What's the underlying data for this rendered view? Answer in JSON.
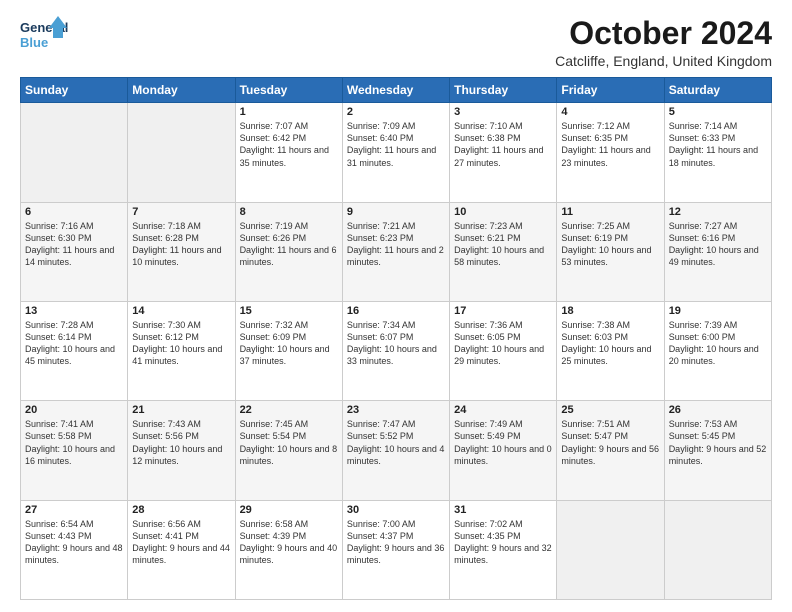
{
  "logo": {
    "line1": "General",
    "line2": "Blue"
  },
  "title": "October 2024",
  "location": "Catcliffe, England, United Kingdom",
  "days_header": [
    "Sunday",
    "Monday",
    "Tuesday",
    "Wednesday",
    "Thursday",
    "Friday",
    "Saturday"
  ],
  "weeks": [
    [
      {
        "day": "",
        "text": ""
      },
      {
        "day": "",
        "text": ""
      },
      {
        "day": "1",
        "text": "Sunrise: 7:07 AM\nSunset: 6:42 PM\nDaylight: 11 hours and 35 minutes."
      },
      {
        "day": "2",
        "text": "Sunrise: 7:09 AM\nSunset: 6:40 PM\nDaylight: 11 hours and 31 minutes."
      },
      {
        "day": "3",
        "text": "Sunrise: 7:10 AM\nSunset: 6:38 PM\nDaylight: 11 hours and 27 minutes."
      },
      {
        "day": "4",
        "text": "Sunrise: 7:12 AM\nSunset: 6:35 PM\nDaylight: 11 hours and 23 minutes."
      },
      {
        "day": "5",
        "text": "Sunrise: 7:14 AM\nSunset: 6:33 PM\nDaylight: 11 hours and 18 minutes."
      }
    ],
    [
      {
        "day": "6",
        "text": "Sunrise: 7:16 AM\nSunset: 6:30 PM\nDaylight: 11 hours and 14 minutes."
      },
      {
        "day": "7",
        "text": "Sunrise: 7:18 AM\nSunset: 6:28 PM\nDaylight: 11 hours and 10 minutes."
      },
      {
        "day": "8",
        "text": "Sunrise: 7:19 AM\nSunset: 6:26 PM\nDaylight: 11 hours and 6 minutes."
      },
      {
        "day": "9",
        "text": "Sunrise: 7:21 AM\nSunset: 6:23 PM\nDaylight: 11 hours and 2 minutes."
      },
      {
        "day": "10",
        "text": "Sunrise: 7:23 AM\nSunset: 6:21 PM\nDaylight: 10 hours and 58 minutes."
      },
      {
        "day": "11",
        "text": "Sunrise: 7:25 AM\nSunset: 6:19 PM\nDaylight: 10 hours and 53 minutes."
      },
      {
        "day": "12",
        "text": "Sunrise: 7:27 AM\nSunset: 6:16 PM\nDaylight: 10 hours and 49 minutes."
      }
    ],
    [
      {
        "day": "13",
        "text": "Sunrise: 7:28 AM\nSunset: 6:14 PM\nDaylight: 10 hours and 45 minutes."
      },
      {
        "day": "14",
        "text": "Sunrise: 7:30 AM\nSunset: 6:12 PM\nDaylight: 10 hours and 41 minutes."
      },
      {
        "day": "15",
        "text": "Sunrise: 7:32 AM\nSunset: 6:09 PM\nDaylight: 10 hours and 37 minutes."
      },
      {
        "day": "16",
        "text": "Sunrise: 7:34 AM\nSunset: 6:07 PM\nDaylight: 10 hours and 33 minutes."
      },
      {
        "day": "17",
        "text": "Sunrise: 7:36 AM\nSunset: 6:05 PM\nDaylight: 10 hours and 29 minutes."
      },
      {
        "day": "18",
        "text": "Sunrise: 7:38 AM\nSunset: 6:03 PM\nDaylight: 10 hours and 25 minutes."
      },
      {
        "day": "19",
        "text": "Sunrise: 7:39 AM\nSunset: 6:00 PM\nDaylight: 10 hours and 20 minutes."
      }
    ],
    [
      {
        "day": "20",
        "text": "Sunrise: 7:41 AM\nSunset: 5:58 PM\nDaylight: 10 hours and 16 minutes."
      },
      {
        "day": "21",
        "text": "Sunrise: 7:43 AM\nSunset: 5:56 PM\nDaylight: 10 hours and 12 minutes."
      },
      {
        "day": "22",
        "text": "Sunrise: 7:45 AM\nSunset: 5:54 PM\nDaylight: 10 hours and 8 minutes."
      },
      {
        "day": "23",
        "text": "Sunrise: 7:47 AM\nSunset: 5:52 PM\nDaylight: 10 hours and 4 minutes."
      },
      {
        "day": "24",
        "text": "Sunrise: 7:49 AM\nSunset: 5:49 PM\nDaylight: 10 hours and 0 minutes."
      },
      {
        "day": "25",
        "text": "Sunrise: 7:51 AM\nSunset: 5:47 PM\nDaylight: 9 hours and 56 minutes."
      },
      {
        "day": "26",
        "text": "Sunrise: 7:53 AM\nSunset: 5:45 PM\nDaylight: 9 hours and 52 minutes."
      }
    ],
    [
      {
        "day": "27",
        "text": "Sunrise: 6:54 AM\nSunset: 4:43 PM\nDaylight: 9 hours and 48 minutes."
      },
      {
        "day": "28",
        "text": "Sunrise: 6:56 AM\nSunset: 4:41 PM\nDaylight: 9 hours and 44 minutes."
      },
      {
        "day": "29",
        "text": "Sunrise: 6:58 AM\nSunset: 4:39 PM\nDaylight: 9 hours and 40 minutes."
      },
      {
        "day": "30",
        "text": "Sunrise: 7:00 AM\nSunset: 4:37 PM\nDaylight: 9 hours and 36 minutes."
      },
      {
        "day": "31",
        "text": "Sunrise: 7:02 AM\nSunset: 4:35 PM\nDaylight: 9 hours and 32 minutes."
      },
      {
        "day": "",
        "text": ""
      },
      {
        "day": "",
        "text": ""
      }
    ]
  ]
}
